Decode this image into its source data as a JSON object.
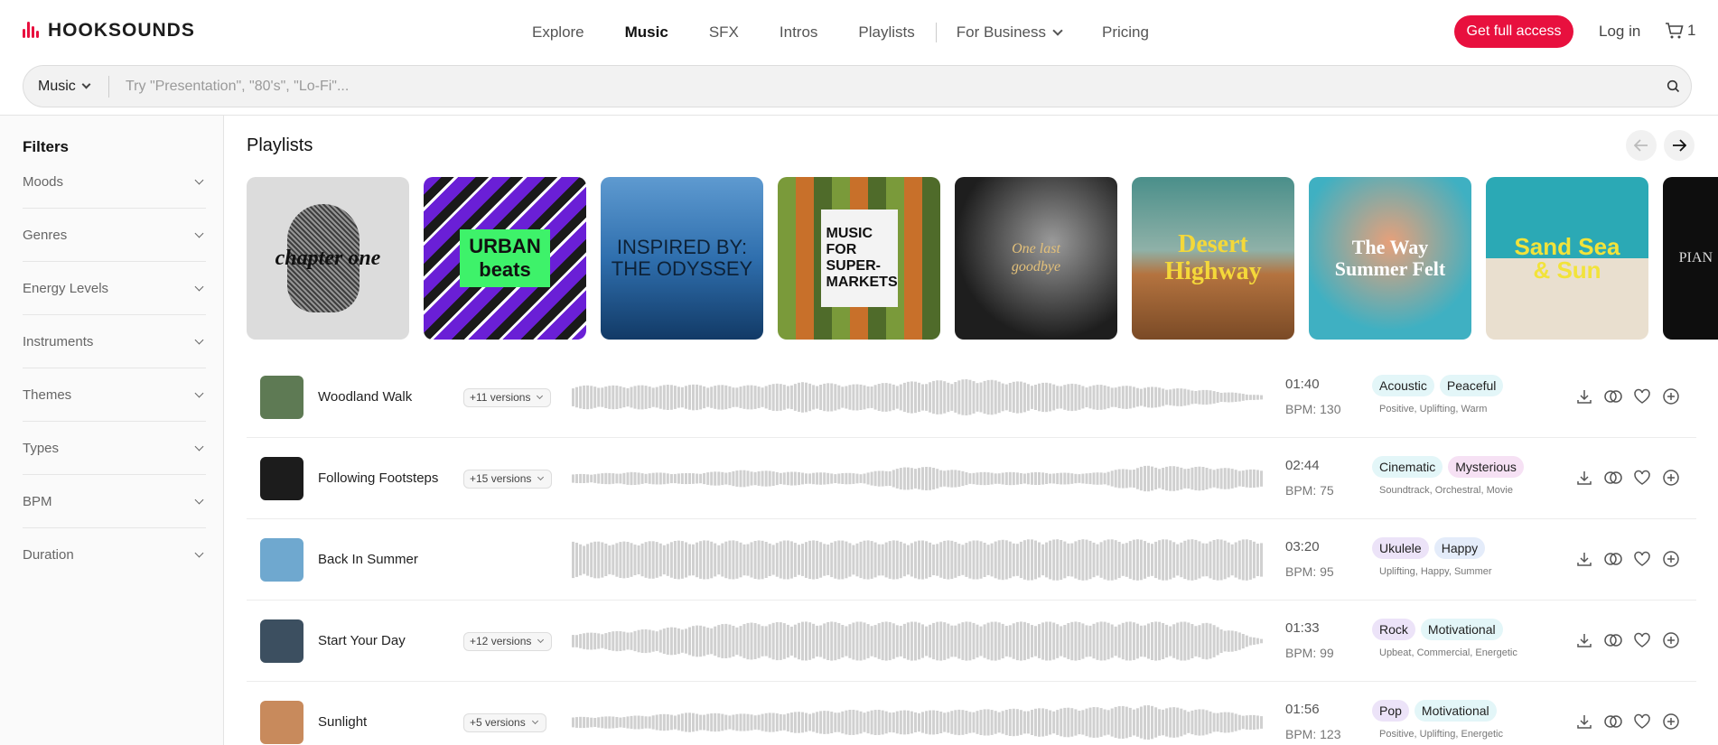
{
  "brand": {
    "name": "HOOKSOUNDS",
    "accent": "#e8103e"
  },
  "nav": {
    "items": [
      {
        "label": "Explore",
        "active": false
      },
      {
        "label": "Music",
        "active": true
      },
      {
        "label": "SFX",
        "active": false
      },
      {
        "label": "Intros",
        "active": false
      },
      {
        "label": "Playlists",
        "active": false
      },
      {
        "label": "For Business",
        "active": false,
        "dropdown": true
      },
      {
        "label": "Pricing",
        "active": false
      }
    ]
  },
  "header": {
    "cta_label": "Get full access",
    "login_label": "Log in",
    "cart_count": "1"
  },
  "search": {
    "type_label": "Music",
    "placeholder": "Try \"Presentation\", \"80's\", \"Lo-Fi\"..."
  },
  "filters": {
    "title": "Filters",
    "items": [
      "Moods",
      "Genres",
      "Energy Levels",
      "Instruments",
      "Themes",
      "Types",
      "BPM",
      "Duration"
    ]
  },
  "playlists": {
    "title": "Playlists",
    "covers": [
      {
        "text": "chapter one",
        "bg": "#dcdcdc"
      },
      {
        "text": "URBAN beats",
        "bg": "#6a1fd6"
      },
      {
        "text": "INSPIRED BY: THE ODYSSEY",
        "bg": "#2f6fae"
      },
      {
        "text": "MUSIC FOR SUPER-MARKETS",
        "bg": "#6b5a2a"
      },
      {
        "text": "One last goodbye",
        "bg": "#1e1e1e"
      },
      {
        "text": "Desert Highway",
        "bg": "#4a8f8a"
      },
      {
        "text": "The Way Summer Felt",
        "bg": "#3fb0c2"
      },
      {
        "text": "Sand Sea & Sun",
        "bg": "#2ba9b5"
      },
      {
        "text": "PIAN",
        "bg": "#0e0e0e"
      }
    ]
  },
  "tracks": [
    {
      "title": "Woodland Walk",
      "versions": "+11 versions",
      "duration": "01:40",
      "bpm": "BPM: 130",
      "tags": [
        "Acoustic",
        "Peaceful"
      ],
      "tag_colors": [
        "#e3f6f8",
        "#e3f6f8"
      ],
      "subtags": "Positive, Uplifting, Warm",
      "thumb": "#5e7a54"
    },
    {
      "title": "Following Footsteps",
      "versions": "+15 versions",
      "duration": "02:44",
      "bpm": "BPM: 75",
      "tags": [
        "Cinematic",
        "Mysterious"
      ],
      "tag_colors": [
        "#e3f6f8",
        "#f6e1f4"
      ],
      "subtags": "Soundtrack, Orchestral, Movie",
      "thumb": "#1c1c1c"
    },
    {
      "title": "Back In Summer",
      "versions": "",
      "duration": "03:20",
      "bpm": "BPM: 95",
      "tags": [
        "Ukulele",
        "Happy"
      ],
      "tag_colors": [
        "#ece3f8",
        "#e4ecfa"
      ],
      "subtags": "Uplifting, Happy, Summer",
      "thumb": "#6fa8cf"
    },
    {
      "title": "Start Your Day",
      "versions": "+12 versions",
      "duration": "01:33",
      "bpm": "BPM: 99",
      "tags": [
        "Rock",
        "Motivational"
      ],
      "tag_colors": [
        "#ece3f8",
        "#e3f6f8"
      ],
      "subtags": "Upbeat, Commercial, Energetic",
      "thumb": "#3c4f60"
    },
    {
      "title": "Sunlight",
      "versions": "+5 versions",
      "duration": "01:56",
      "bpm": "BPM: 123",
      "tags": [
        "Pop",
        "Motivational"
      ],
      "tag_colors": [
        "#ece3f8",
        "#e3f6f8"
      ],
      "subtags": "Positive, Uplifting, Energetic",
      "thumb": "#c88a5c"
    }
  ],
  "icons": {
    "cart": "cart-icon",
    "search": "search-icon",
    "download": "download-icon",
    "similar": "similar-icon",
    "favorite": "heart-icon",
    "add": "plus-circle-icon"
  }
}
